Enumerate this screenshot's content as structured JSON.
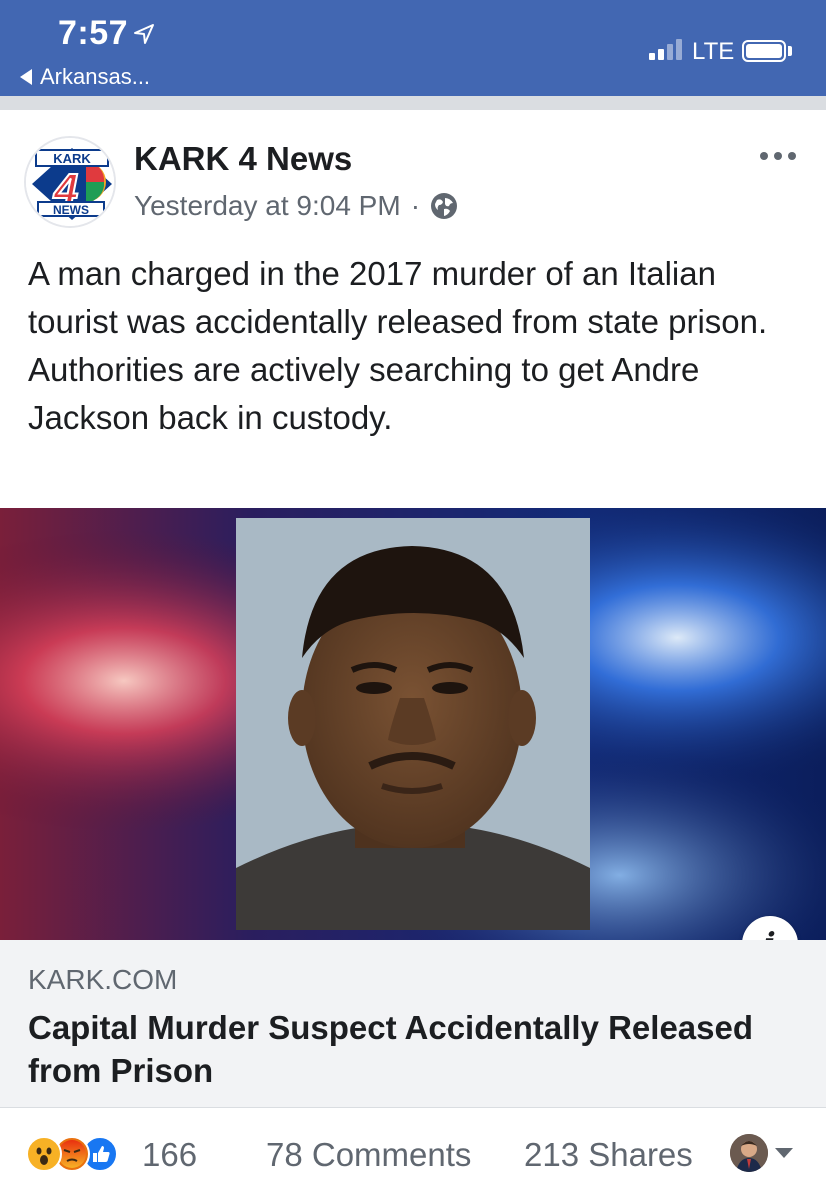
{
  "status_bar": {
    "time": "7:57",
    "back_label": "Arkansas...",
    "network": "LTE",
    "background": "#4267b2"
  },
  "post": {
    "page_name": "KARK 4 News",
    "avatar": {
      "top_text": "KARK",
      "number": "4",
      "bottom_text": "NEWS"
    },
    "timestamp": "Yesterday at 9:04 PM",
    "separator": "·",
    "privacy_icon": "globe-icon",
    "text": "A man charged in the 2017 murder of an Italian tourist was accidentally released from state prison. Authorities are actively searching to get Andre Jackson back in custody."
  },
  "link": {
    "domain": "KARK.COM",
    "title": "Capital Murder Suspect Accidentally Released from Prison",
    "info_glyph": "i",
    "image": "mugshot-over-police-lights"
  },
  "footer": {
    "reaction_icons": [
      "wow-icon",
      "angry-icon",
      "like-icon"
    ],
    "reaction_count": "166",
    "comments": "78 Comments",
    "shares": "213 Shares"
  }
}
